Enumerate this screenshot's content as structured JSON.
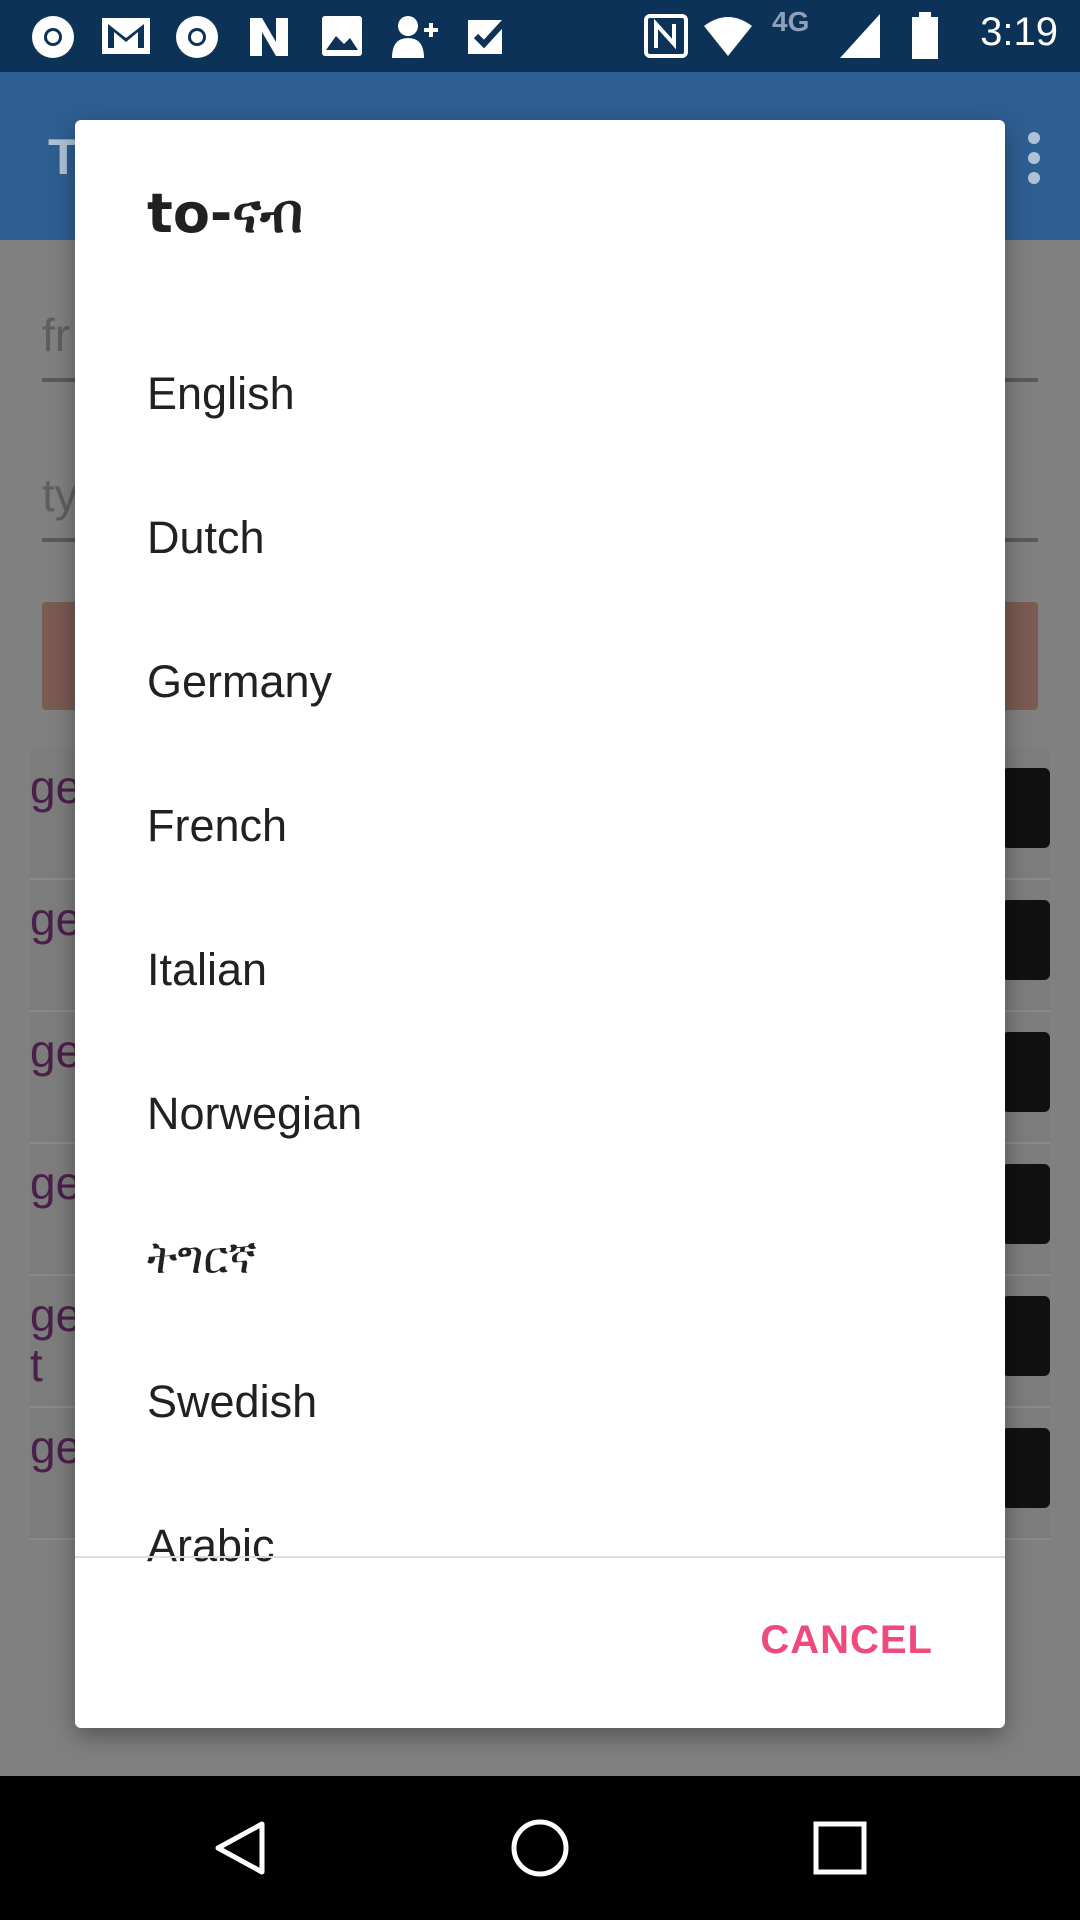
{
  "status_bar": {
    "time": "3:19",
    "network": "4G",
    "icons": [
      "chrome-icon",
      "gmail-icon",
      "chrome-icon",
      "n-icon",
      "image-icon",
      "add-contact-icon",
      "check-icon",
      "nfc-icon",
      "wifi-icon",
      "signal-icon",
      "battery-icon"
    ]
  },
  "app_bar": {
    "title": "T"
  },
  "background": {
    "field1_text": "fr",
    "field2_text": "ty",
    "rows": [
      "ge",
      "ge",
      "ge",
      "ge",
      "ge\nt",
      "ge"
    ]
  },
  "dialog": {
    "title": "to-ናብ",
    "options": [
      "English",
      "Dutch",
      "Germany",
      "French",
      "Italian",
      "Norwegian",
      "ትግርኛ",
      "Swedish",
      "Arabic"
    ],
    "cancel_label": "CANCEL",
    "accent_color": "#EF4A7C"
  },
  "nav_bar": {
    "icons": [
      "back-icon",
      "home-icon",
      "recents-icon"
    ]
  }
}
